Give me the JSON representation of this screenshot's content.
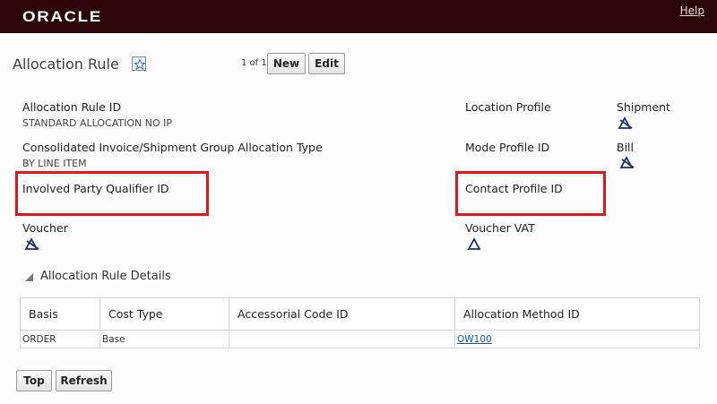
{
  "header": {
    "logo": "ORACLE",
    "help": "Help"
  },
  "page": {
    "title": "Allocation Rule",
    "pager": "1 of 1",
    "new_label": "New",
    "edit_label": "Edit"
  },
  "fields": {
    "rule_id_label": "Allocation Rule ID",
    "rule_id_value": "STANDARD ALLOCATION NO IP",
    "group_type_label": "Consolidated Invoice/Shipment Group Allocation Type",
    "group_type_value": "BY LINE ITEM",
    "involved_party_label": "Involved Party Qualifier ID",
    "voucher_label": "Voucher",
    "location_profile_label": "Location Profile",
    "mode_profile_label": "Mode Profile ID",
    "contact_profile_label": "Contact Profile ID",
    "voucher_vat_label": "Voucher VAT",
    "shipment_label": "Shipment",
    "bill_label": "Bill"
  },
  "details": {
    "section_title": "Allocation Rule Details",
    "columns": [
      "Basis",
      "Cost Type",
      "Accessorial Code ID",
      "Allocation Method ID"
    ],
    "rows": [
      {
        "basis": "ORDER",
        "cost_type": "Base",
        "accessorial": "",
        "method": "OW100"
      }
    ]
  },
  "footer": {
    "top_label": "Top",
    "refresh_label": "Refresh"
  },
  "colors": {
    "header_bg": "#2d0609",
    "highlight": "#e2171e",
    "link": "#0c5aa6"
  },
  "icons": [
    "favorite-star-icon",
    "not-selected-icon",
    "selected-icon",
    "triangle-collapse-icon"
  ]
}
